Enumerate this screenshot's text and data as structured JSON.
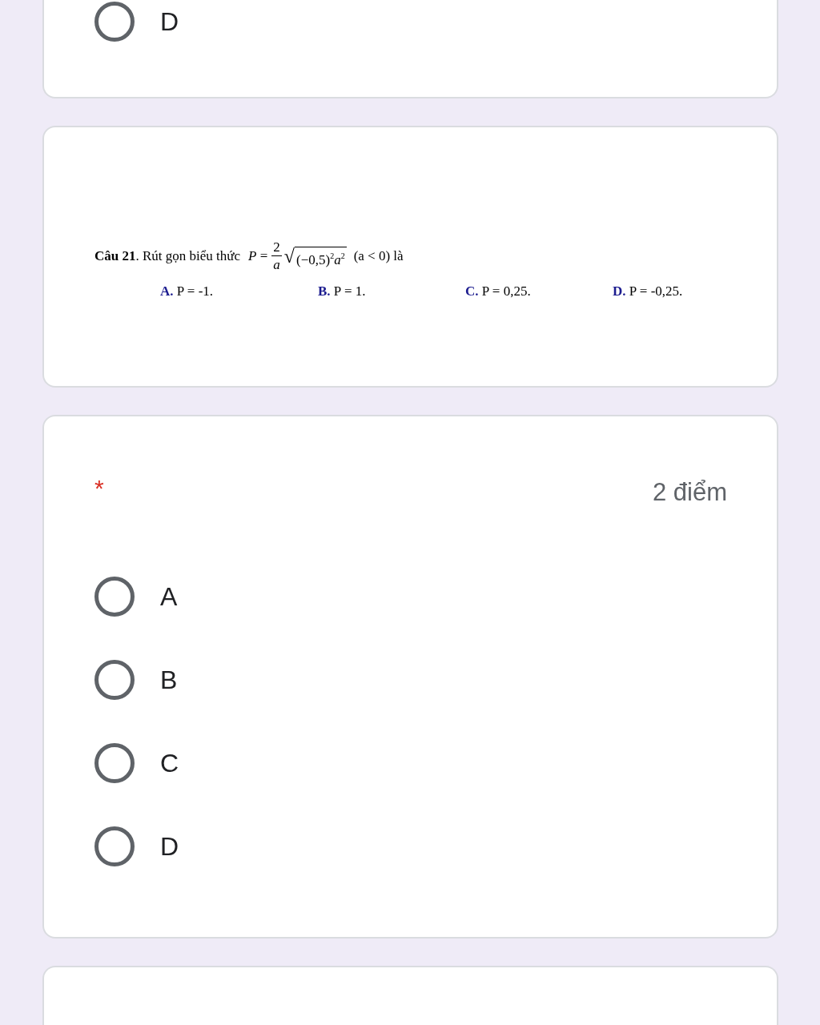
{
  "questions": [
    {
      "kind": "choice",
      "options": [
        {
          "label": "D",
          "selected": false
        }
      ]
    },
    {
      "kind": "document",
      "lead": "**Câu 21**. Rút gọn biểu thức",
      "formula": {
        "lhs": "*P* =",
        "numerator": "2",
        "denominator": "a",
        "radical": "√",
        "radicand": "(−0,5)$^{2}$*a*$^{2}$"
      },
      "tail": "(a < 0) là",
      "answers": [
        {
          "letter": "A.",
          "text": "P = -1."
        },
        {
          "letter": "B.",
          "text": "P = 1."
        },
        {
          "letter": "C.",
          "text": "P = 0,25."
        },
        {
          "letter": "D.",
          "text": "P = -0,25."
        }
      ]
    },
    {
      "kind": "choice",
      "required_mark": "*",
      "points": "2 điểm",
      "options": [
        {
          "label": "A",
          "selected": false
        },
        {
          "label": "B",
          "selected": false
        },
        {
          "label": "C",
          "selected": false
        },
        {
          "label": "D",
          "selected": false
        }
      ]
    },
    {
      "kind": "empty"
    }
  ]
}
